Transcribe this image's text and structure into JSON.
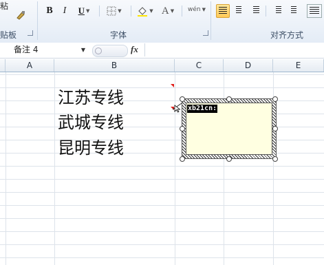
{
  "ribbon": {
    "clipboard": {
      "paste_label": "粘",
      "group_label": "贴板"
    },
    "font": {
      "bold": "B",
      "italic": "I",
      "underline": "U",
      "font_color_label": "A",
      "phonetic_label": "wén",
      "group_label": "字体"
    },
    "alignment": {
      "group_label": "对齐方式"
    }
  },
  "formula_bar": {
    "name_box_value": "备注 4",
    "fx_label": "fx",
    "formula_value": ""
  },
  "columns": [
    "A",
    "B",
    "C",
    "D",
    "E"
  ],
  "cells": [
    {
      "ref": "B",
      "text": "江苏专线"
    },
    {
      "ref": "B",
      "text": "武城专线"
    },
    {
      "ref": "B",
      "text": "昆明专线"
    }
  ],
  "comment": {
    "author": "xb21cn:",
    "text": "",
    "background": "#ffffe1"
  },
  "colors": {
    "ribbon_bg": "#e4ecf6",
    "comment_indicator": "#e0201c",
    "active_align": "#ffc956"
  }
}
